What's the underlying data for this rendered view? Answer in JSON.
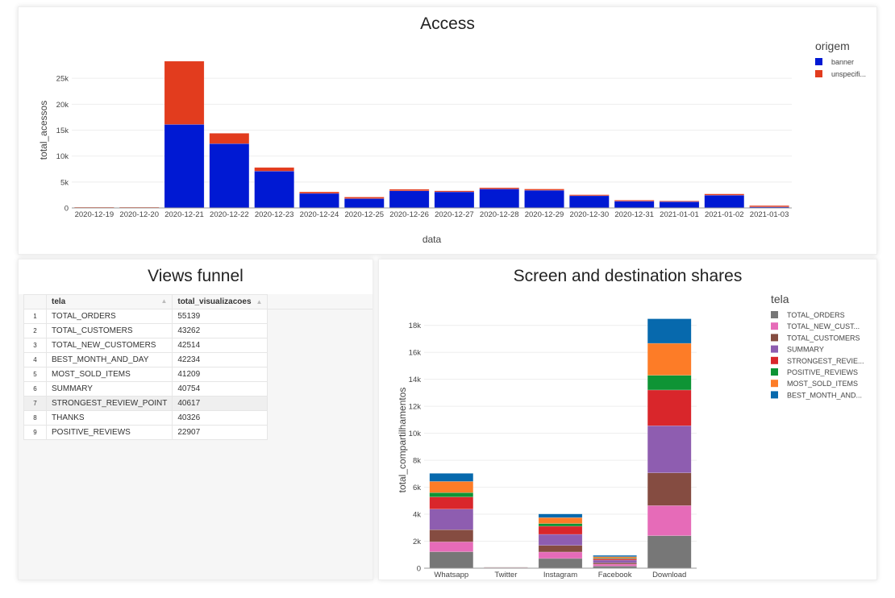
{
  "access_chart": {
    "title": "Access",
    "chart_data": {
      "type": "bar",
      "stacked": true,
      "title": "Access",
      "xlabel": "data",
      "ylabel": "total_acessos",
      "ylim": [
        0,
        30000
      ],
      "yticks": [
        0,
        5000,
        10000,
        15000,
        20000,
        25000
      ],
      "ytick_labels": [
        "0",
        "5k",
        "10k",
        "15k",
        "20k",
        "25k"
      ],
      "grid": true,
      "legend_title": "origem",
      "legend_placement": "top-right",
      "categories": [
        "2020-12-19",
        "2020-12-20",
        "2020-12-21",
        "2020-12-22",
        "2020-12-23",
        "2020-12-24",
        "2020-12-25",
        "2020-12-26",
        "2020-12-27",
        "2020-12-28",
        "2020-12-29",
        "2020-12-30",
        "2020-12-31",
        "2021-01-01",
        "2021-01-02",
        "2021-01-03"
      ],
      "series": [
        {
          "name": "banner",
          "color": "#0019d3",
          "values": [
            50,
            50,
            16100,
            12400,
            7100,
            2800,
            1800,
            3300,
            3100,
            3650,
            3400,
            2350,
            1300,
            1200,
            2450,
            200
          ]
        },
        {
          "name": "unspecifi...",
          "color": "#e23c1e",
          "values": [
            100,
            100,
            12200,
            2000,
            700,
            300,
            300,
            300,
            200,
            250,
            250,
            200,
            200,
            150,
            250,
            250
          ]
        }
      ]
    }
  },
  "views_funnel": {
    "title": "Views funnel",
    "columns": [
      "tela",
      "total_visualizacoes"
    ],
    "sort_icon": "sort-arrow-up-icon",
    "highlighted_row": 7,
    "rows": [
      {
        "index": "1",
        "tela": "TOTAL_ORDERS",
        "total": "55139"
      },
      {
        "index": "2",
        "tela": "TOTAL_CUSTOMERS",
        "total": "43262"
      },
      {
        "index": "3",
        "tela": "TOTAL_NEW_CUSTOMERS",
        "total": "42514"
      },
      {
        "index": "4",
        "tela": "BEST_MONTH_AND_DAY",
        "total": "42234"
      },
      {
        "index": "5",
        "tela": "MOST_SOLD_ITEMS",
        "total": "41209"
      },
      {
        "index": "6",
        "tela": "SUMMARY",
        "total": "40754"
      },
      {
        "index": "7",
        "tela": "STRONGEST_REVIEW_POINT",
        "total": "40617"
      },
      {
        "index": "8",
        "tela": "THANKS",
        "total": "40326"
      },
      {
        "index": "9",
        "tela": "POSITIVE_REVIEWS",
        "total": "22907"
      }
    ]
  },
  "shares_chart": {
    "title": "Screen and destination shares",
    "chart_data": {
      "type": "bar",
      "stacked": true,
      "title": "Screen and destination shares",
      "xlabel": "",
      "ylabel": "total_compartilhamentos",
      "ylim": [
        0,
        19000
      ],
      "yticks": [
        0,
        2000,
        4000,
        6000,
        8000,
        10000,
        12000,
        14000,
        16000,
        18000
      ],
      "ytick_labels": [
        "0",
        "2k",
        "4k",
        "6k",
        "8k",
        "10k",
        "12k",
        "14k",
        "16k",
        "18k"
      ],
      "grid": true,
      "legend_title": "tela",
      "legend_placement": "top-right",
      "categories": [
        "Whatsapp",
        "Twitter",
        "Instagram",
        "Facebook",
        "Download"
      ],
      "series": [
        {
          "name": "TOTAL_ORDERS",
          "color": "#777777",
          "values": [
            1220,
            15,
            720,
            150,
            2410
          ]
        },
        {
          "name": "TOTAL_NEW_CUST...",
          "color": "#e66bb8",
          "values": [
            730,
            10,
            480,
            150,
            2230
          ]
        },
        {
          "name": "TOTAL_CUSTOMERS",
          "color": "#854c41",
          "values": [
            900,
            10,
            490,
            100,
            2430
          ]
        },
        {
          "name": "SUMMARY",
          "color": "#8e5db0",
          "values": [
            1530,
            15,
            820,
            200,
            3490
          ]
        },
        {
          "name": "STRONGEST_REVIE...",
          "color": "#d9262b",
          "values": [
            900,
            10,
            600,
            100,
            2650
          ]
        },
        {
          "name": "POSITIVE_REVIEWS",
          "color": "#0e9435",
          "values": [
            320,
            5,
            200,
            50,
            1090
          ]
        },
        {
          "name": "MOST_SOLD_ITEMS",
          "color": "#fd7c27",
          "values": [
            830,
            10,
            440,
            100,
            2370
          ]
        },
        {
          "name": "BEST_MONTH_AND...",
          "color": "#0769ad",
          "values": [
            600,
            5,
            270,
            100,
            1820
          ]
        }
      ]
    }
  }
}
